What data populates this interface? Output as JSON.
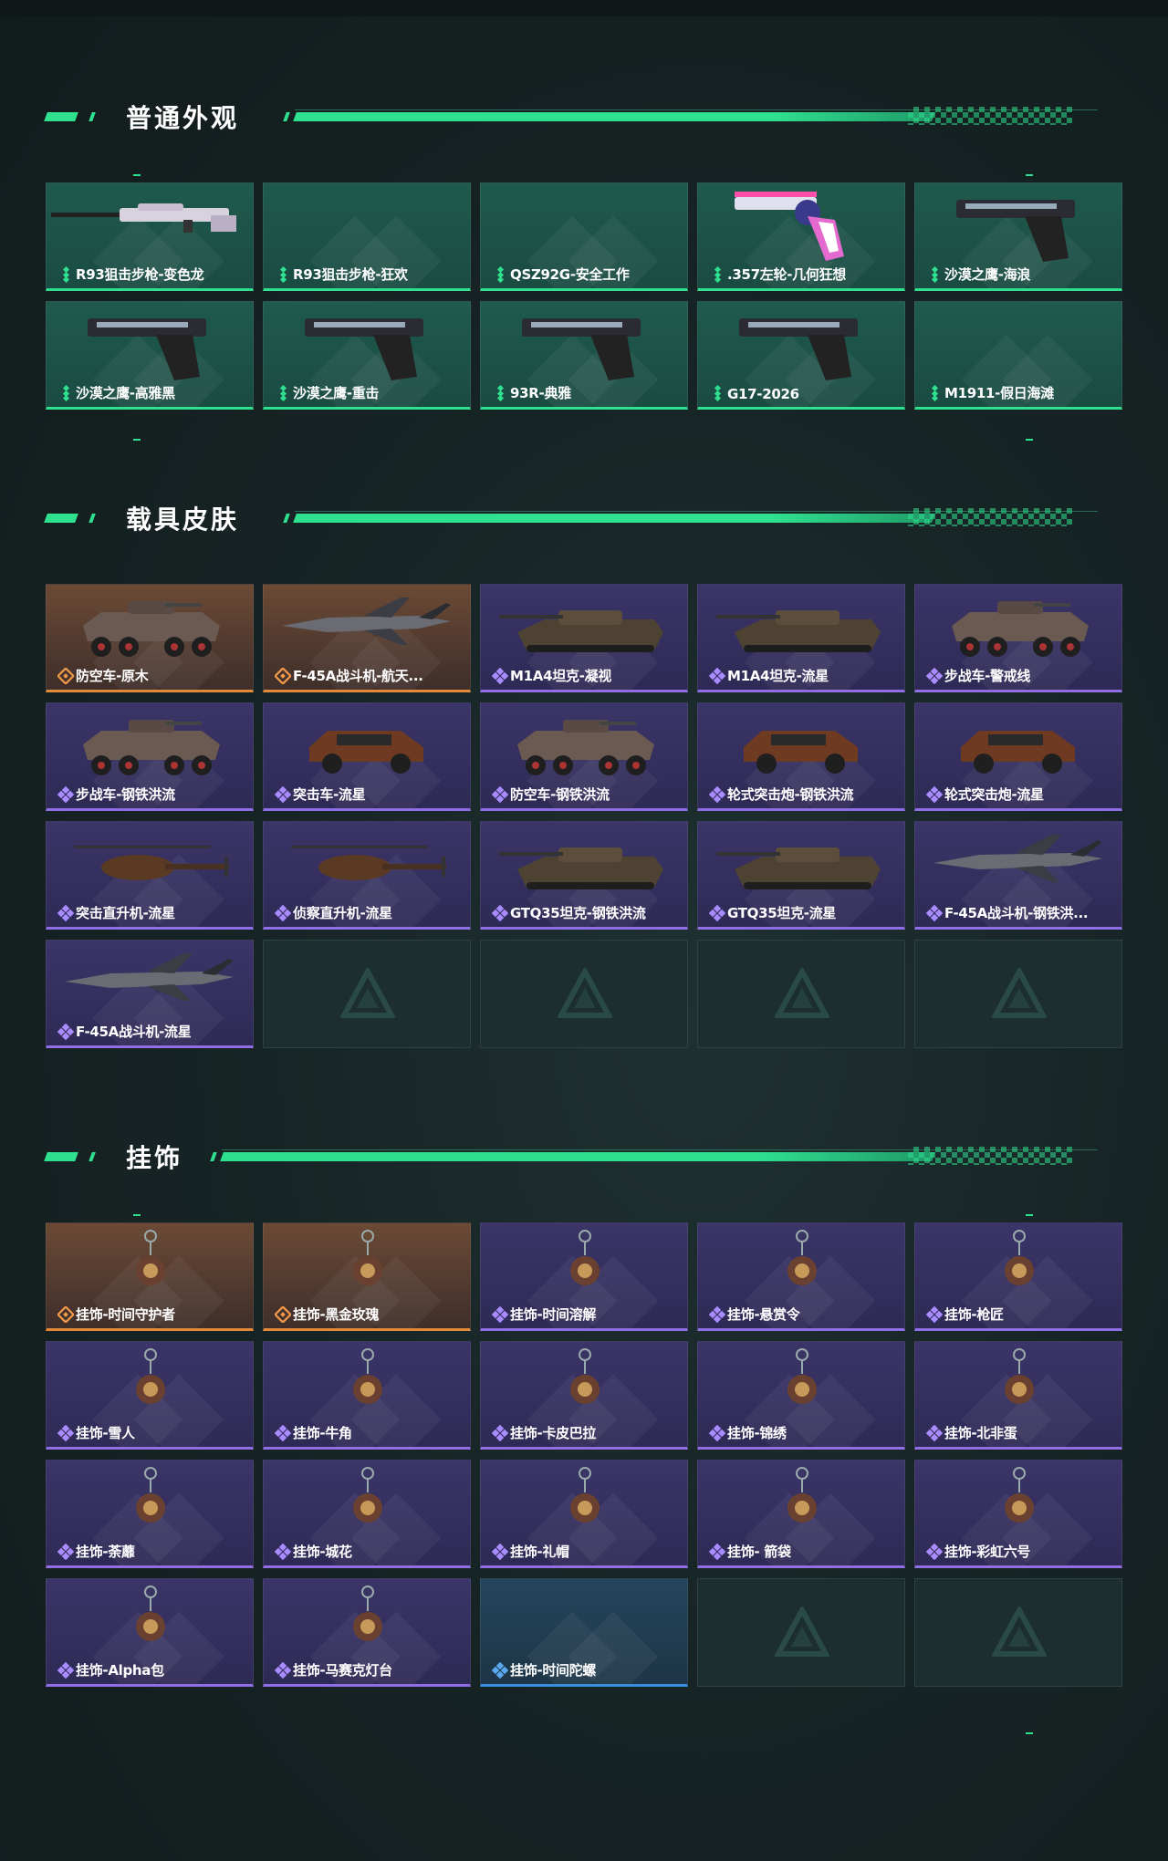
{
  "sections": [
    {
      "title": "普通外观",
      "items": [
        {
          "label": "R93狙击步枪-变色龙",
          "rarity": "green",
          "icon": "sniper-rifle-icon"
        },
        {
          "label": "R93狙击步枪-狂欢",
          "rarity": "green",
          "icon": ""
        },
        {
          "label": "QSZ92G-安全工作",
          "rarity": "green",
          "icon": ""
        },
        {
          "label": ".357左轮-几何狂想",
          "rarity": "green",
          "icon": "revolver-icon"
        },
        {
          "label": "沙漠之鹰-海浪",
          "rarity": "green",
          "icon": "pistol-icon"
        },
        {
          "label": "沙漠之鹰-高雅黑",
          "rarity": "green",
          "icon": "pistol-icon"
        },
        {
          "label": "沙漠之鹰-重击",
          "rarity": "green",
          "icon": "pistol-icon"
        },
        {
          "label": "93R-典雅",
          "rarity": "green",
          "icon": "pistol-icon"
        },
        {
          "label": "G17-2026",
          "rarity": "green",
          "icon": "pistol-icon"
        },
        {
          "label": "M1911-假日海滩",
          "rarity": "green",
          "icon": ""
        }
      ]
    },
    {
      "title": "载具皮肤",
      "items": [
        {
          "label": "防空车-原木",
          "rarity": "orange",
          "icon": "apc-icon"
        },
        {
          "label": "F-45A战斗机-航天...",
          "rarity": "orange",
          "icon": "jet-icon"
        },
        {
          "label": "M1A4坦克-凝视",
          "rarity": "purple",
          "icon": "tank-icon"
        },
        {
          "label": "M1A4坦克-流星",
          "rarity": "purple",
          "icon": "tank-icon"
        },
        {
          "label": "步战车-警戒线",
          "rarity": "purple",
          "icon": "apc-icon"
        },
        {
          "label": "步战车-钢铁洪流",
          "rarity": "purple",
          "icon": "apc-icon"
        },
        {
          "label": "突击车-流星",
          "rarity": "purple",
          "icon": "car-icon"
        },
        {
          "label": "防空车-钢铁洪流",
          "rarity": "purple",
          "icon": "apc-icon"
        },
        {
          "label": "轮式突击炮-钢铁洪流",
          "rarity": "purple",
          "icon": "car-icon"
        },
        {
          "label": "轮式突击炮-流星",
          "rarity": "purple",
          "icon": "car-icon"
        },
        {
          "label": "突击直升机-流星",
          "rarity": "purple",
          "icon": "helicopter-icon"
        },
        {
          "label": "侦察直升机-流星",
          "rarity": "purple",
          "icon": "helicopter-icon"
        },
        {
          "label": "GTQ35坦克-钢铁洪流",
          "rarity": "purple",
          "icon": "tank-icon"
        },
        {
          "label": "GTQ35坦克-流星",
          "rarity": "purple",
          "icon": "tank-icon"
        },
        {
          "label": "F-45A战斗机-钢铁洪...",
          "rarity": "purple",
          "icon": "jet-icon"
        },
        {
          "label": "F-45A战斗机-流星",
          "rarity": "purple",
          "icon": "jet-icon"
        },
        {
          "label": "",
          "rarity": "empty",
          "icon": ""
        },
        {
          "label": "",
          "rarity": "empty",
          "icon": ""
        },
        {
          "label": "",
          "rarity": "empty",
          "icon": ""
        },
        {
          "label": "",
          "rarity": "empty",
          "icon": ""
        }
      ]
    },
    {
      "title": "挂饰",
      "items": [
        {
          "label": "挂饰-时间守护者",
          "rarity": "orange",
          "icon": "charm-icon"
        },
        {
          "label": "挂饰-黑金玫瑰",
          "rarity": "orange",
          "icon": "charm-icon"
        },
        {
          "label": "挂饰-时间溶解",
          "rarity": "purple",
          "icon": "charm-icon"
        },
        {
          "label": "挂饰-悬赏令",
          "rarity": "purple",
          "icon": "charm-icon"
        },
        {
          "label": "挂饰-枪匠",
          "rarity": "purple",
          "icon": "charm-icon"
        },
        {
          "label": "挂饰-雪人",
          "rarity": "purple",
          "icon": "charm-icon"
        },
        {
          "label": "挂饰-牛角",
          "rarity": "purple",
          "icon": "charm-icon"
        },
        {
          "label": "挂饰-卡皮巴拉",
          "rarity": "purple",
          "icon": "charm-icon"
        },
        {
          "label": "挂饰-锦绣",
          "rarity": "purple",
          "icon": "charm-icon"
        },
        {
          "label": "挂饰-北非蛋",
          "rarity": "purple",
          "icon": "charm-icon"
        },
        {
          "label": "挂饰-荼蘼",
          "rarity": "purple",
          "icon": "charm-icon"
        },
        {
          "label": "挂饰-城花",
          "rarity": "purple",
          "icon": "charm-icon"
        },
        {
          "label": "挂饰-礼帽",
          "rarity": "purple",
          "icon": "charm-icon"
        },
        {
          "label": "挂饰- 箭袋",
          "rarity": "purple",
          "icon": "charm-icon"
        },
        {
          "label": "挂饰-彩虹六号",
          "rarity": "purple",
          "icon": "charm-icon"
        },
        {
          "label": "挂饰-Alpha包",
          "rarity": "purple",
          "icon": "charm-icon"
        },
        {
          "label": "挂饰-马赛克灯台",
          "rarity": "purple",
          "icon": "charm-icon"
        },
        {
          "label": "挂饰-时间陀螺",
          "rarity": "blue",
          "icon": ""
        },
        {
          "label": "",
          "rarity": "empty",
          "icon": ""
        },
        {
          "label": "",
          "rarity": "empty",
          "icon": ""
        }
      ]
    }
  ],
  "colors": {
    "accent_green": "#2fe08f",
    "rarity_green": "#2fe08f",
    "rarity_purple": "#8f6ee6",
    "rarity_orange": "#e08a3a",
    "rarity_blue": "#3a8ee0"
  }
}
